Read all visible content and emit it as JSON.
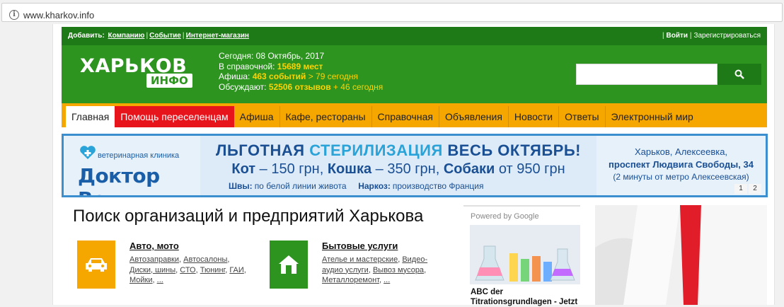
{
  "browser": {
    "url": "www.kharkov.info"
  },
  "topbar": {
    "add_label": "Добавить:",
    "links": [
      "Компанию",
      "Событие",
      "Интернет-магазин"
    ],
    "login": "Войти",
    "register": "Зарегистрироваться"
  },
  "header": {
    "logo_top": "ХАРЬКОВ",
    "logo_bottom": "ИНФО",
    "stats": {
      "today_label": "Сегодня:",
      "today_value": "08 Октябрь, 2017",
      "directory_label": "В справочной:",
      "directory_value": "15689 мест",
      "afisha_label": "Афиша:",
      "afisha_value": "463 событий",
      "afisha_today": "> 79 сегодня",
      "discuss_label": "Обсуждают:",
      "discuss_value": "52506 отзывов",
      "discuss_today": "+ 46 сегодня"
    },
    "search": {
      "placeholder": ""
    }
  },
  "nav": {
    "items": [
      {
        "label": "Главная"
      },
      {
        "label": "Помощь переселенцам"
      },
      {
        "label": "Афиша"
      },
      {
        "label": "Кафе, рестораны"
      },
      {
        "label": "Справочная"
      },
      {
        "label": "Объявления"
      },
      {
        "label": "Новости"
      },
      {
        "label": "Ответы"
      },
      {
        "label": "Электронный мир"
      }
    ]
  },
  "banner": {
    "clinic_small": "ветеринарная клиника",
    "clinic_name": "Доктор Вет",
    "h1_part1": "ЛЬГОТНАЯ",
    "h1_part2": "СТЕРИЛИЗАЦИЯ",
    "h1_part3": "ВЕСЬ ОКТЯБРЬ!",
    "h2_cat": "Кот",
    "h2_cat_price": "– 150 грн,",
    "h2_kitty": "Кошка",
    "h2_kitty_price": "– 350 грн,",
    "h2_dogs": "Собаки",
    "h2_dogs_price": "от 950 грн",
    "sutures_label": "Швы:",
    "sutures_value": "по белой линии живота",
    "anesth_label": "Наркоз:",
    "anesth_value": "производство Франция",
    "addr1": "Харьков, Алексеевка,",
    "addr2": "проспект Людвига Свободы, 34",
    "addr3": "(2 минуты от метро Алексеевская)",
    "pages": [
      "1",
      "2"
    ]
  },
  "main": {
    "title": "Поиск организаций и предприятий Харькова",
    "categories": [
      {
        "title": "Авто, мото",
        "links": [
          "Автозаправки",
          "Автосалоны",
          "Диски, шины",
          "СТО",
          "Тюнинг",
          "ГАИ",
          "Мойки",
          "..."
        ]
      },
      {
        "title": "Бытовые услуги",
        "links": [
          "Ателье и мастерские",
          "Видео-аудио услуги",
          "Вывоз мусора",
          "Металлоремонт",
          "..."
        ]
      }
    ]
  },
  "ad": {
    "powered": "Powered by Google",
    "text_line1": "ABC der",
    "text_line2": "Titrationsgrundlagen - Jetzt"
  },
  "colors": {
    "green_dark": "#1e7a16",
    "green": "#2d9420",
    "orange": "#f5a700",
    "red": "#e8141c",
    "yellow": "#ffd200",
    "banner_blue": "#3b8fcf"
  }
}
